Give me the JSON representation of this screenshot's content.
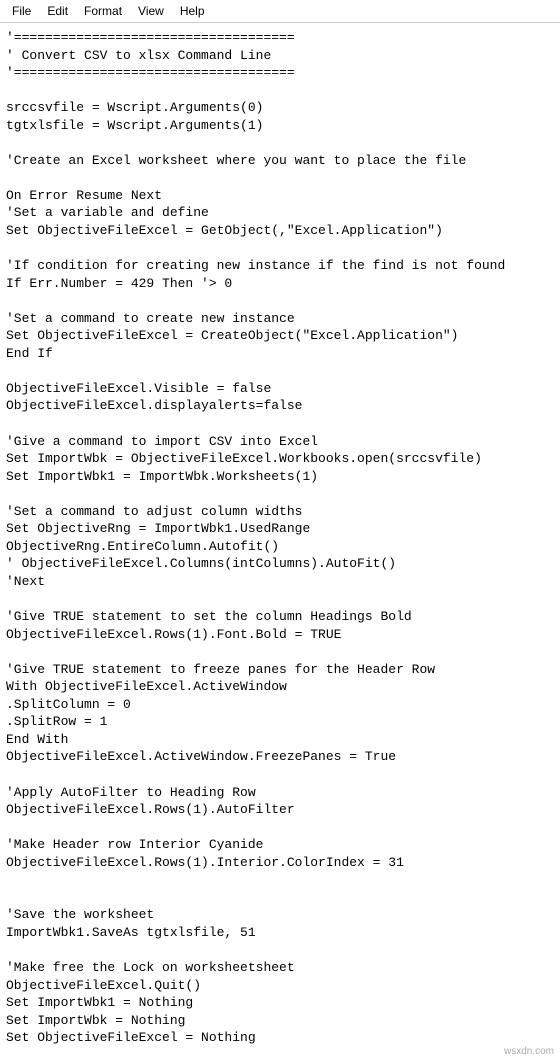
{
  "menubar": {
    "file": "File",
    "edit": "Edit",
    "format": "Format",
    "view": "View",
    "help": "Help"
  },
  "editor": {
    "content": "'====================================\n' Convert CSV to xlsx Command Line\n'====================================\n\nsrccsvfile = Wscript.Arguments(0)\ntgtxlsfile = Wscript.Arguments(1)\n\n'Create an Excel worksheet where you want to place the file\n\nOn Error Resume Next\n'Set a variable and define\nSet ObjectiveFileExcel = GetObject(,\"Excel.Application\")\n\n'If condition for creating new instance if the find is not found\nIf Err.Number = 429 Then '> 0\n\n'Set a command to create new instance\nSet ObjectiveFileExcel = CreateObject(\"Excel.Application\")\nEnd If\n\nObjectiveFileExcel.Visible = false\nObjectiveFileExcel.displayalerts=false\n\n'Give a command to import CSV into Excel\nSet ImportWbk = ObjectiveFileExcel.Workbooks.open(srccsvfile)\nSet ImportWbk1 = ImportWbk.Worksheets(1)\n\n'Set a command to adjust column widths\nSet ObjectiveRng = ImportWbk1.UsedRange\nObjectiveRng.EntireColumn.Autofit()\n' ObjectiveFileExcel.Columns(intColumns).AutoFit()\n'Next\n\n'Give TRUE statement to set the column Headings Bold\nObjectiveFileExcel.Rows(1).Font.Bold = TRUE\n\n'Give TRUE statement to freeze panes for the Header Row\nWith ObjectiveFileExcel.ActiveWindow\n.SplitColumn = 0\n.SplitRow = 1\nEnd With\nObjectiveFileExcel.ActiveWindow.FreezePanes = True\n\n'Apply AutoFilter to Heading Row\nObjectiveFileExcel.Rows(1).AutoFilter\n\n'Make Header row Interior Cyanide\nObjectiveFileExcel.Rows(1).Interior.ColorIndex = 31\n\n\n'Save the worksheet\nImportWbk1.SaveAs tgtxlsfile, 51\n\n'Make free the Lock on worksheetsheet\nObjectiveFileExcel.Quit()\nSet ImportWbk1 = Nothing\nSet ImportWbk = Nothing\nSet ObjectiveFileExcel = Nothing"
  },
  "watermark": "wsxdn.com"
}
